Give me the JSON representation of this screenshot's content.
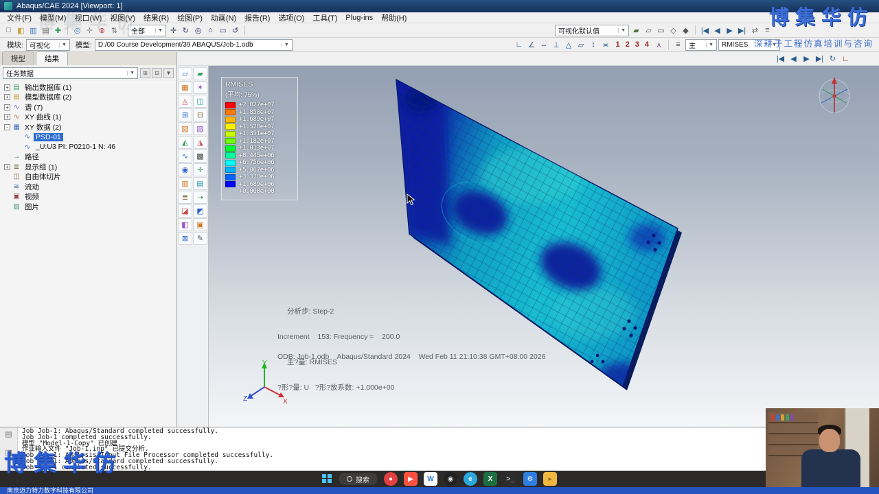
{
  "window": {
    "title": "Abaqus/CAE 2024 [Viewport: 1]"
  },
  "watermark": {
    "brand": "博集华仿",
    "tagline": "深耕于工程仿真培训与咨询"
  },
  "menu": {
    "items": [
      "文件(F)",
      "模型(M)",
      "视口(W)",
      "视图(V)",
      "结果(R)",
      "绘图(P)",
      "动画(N)",
      "报告(R)",
      "选项(O)",
      "工具(T)",
      "Plug-ins",
      "帮助(H)"
    ]
  },
  "toolbar1": {
    "file_icons": [
      {
        "name": "new-file-icon",
        "glyph": "□",
        "color": "#555"
      },
      {
        "name": "open-icon",
        "glyph": "◧",
        "color": "#c8a03a"
      },
      {
        "name": "save-icon",
        "glyph": "▥",
        "color": "#3a6fc0"
      },
      {
        "name": "print-icon",
        "glyph": "▤",
        "color": "#666"
      },
      {
        "name": "manager-icon",
        "glyph": "✚",
        "color": "#2e9e5b"
      }
    ],
    "edit_icons": [
      {
        "name": "query-icon",
        "glyph": "◎",
        "color": "#3a6fc0"
      },
      {
        "name": "tools-icon",
        "glyph": "✛",
        "color": "#888"
      },
      {
        "name": "delete-icon",
        "glyph": "⊗",
        "color": "#b04040"
      },
      {
        "name": "sort-icon",
        "glyph": "⇅",
        "color": "#666"
      }
    ],
    "display_filter": {
      "value": "全部"
    },
    "view_icons": [
      {
        "name": "pan-view-icon",
        "glyph": "✛",
        "color": "#336"
      },
      {
        "name": "rotate-view-icon",
        "glyph": "↻",
        "color": "#336"
      },
      {
        "name": "zoom-view-icon",
        "glyph": "◎",
        "color": "#336"
      },
      {
        "name": "fit-view-icon",
        "glyph": "⌂",
        "color": "#336"
      },
      {
        "name": "box-zoom-icon",
        "glyph": "▭",
        "color": "#336"
      },
      {
        "name": "cycle-views-icon",
        "glyph": "↺",
        "color": "#336"
      }
    ],
    "viz_defaults": {
      "value": "可视化默认值"
    },
    "render_icons": [
      {
        "name": "render-shaded-icon",
        "glyph": "▰",
        "color": "#4a7a3a"
      },
      {
        "name": "render-hidden-icon",
        "glyph": "▱",
        "color": "#555"
      },
      {
        "name": "render-wireframe-icon",
        "glyph": "▭",
        "color": "#555"
      },
      {
        "name": "perspective-icon",
        "glyph": "◇",
        "color": "#555"
      },
      {
        "name": "parallel-icon",
        "glyph": "◆",
        "color": "#555"
      }
    ],
    "playback_icons": [
      {
        "name": "first-frame-icon",
        "glyph": "|◀",
        "color": "#2a5a8a"
      },
      {
        "name": "previous-frame-icon",
        "glyph": "◀",
        "color": "#2a5a8a"
      },
      {
        "name": "play-animation-icon",
        "glyph": "▶",
        "color": "#2a5a8a"
      },
      {
        "name": "last-frame-icon",
        "glyph": "▶|",
        "color": "#2a5a8a"
      }
    ],
    "tail_icons": [
      {
        "name": "sync-viewports-icon",
        "glyph": "⇄",
        "color": "#666"
      },
      {
        "name": "viewport-annotations-icon",
        "glyph": "≡",
        "color": "#666"
      }
    ]
  },
  "context": {
    "module_label": "模块:",
    "module_value": "可视化",
    "model_label": "模型:",
    "model_value": "D:/00 Course Development/39 ABAQUS/Job-1.odb",
    "annotation_icons": [
      {
        "name": "measure-distance-icon",
        "glyph": "∟",
        "color": "#2a5a8a"
      },
      {
        "name": "measure-angle-icon",
        "glyph": "∠",
        "color": "#2a5a8a"
      },
      {
        "name": "annotate-arrow-icon",
        "glyph": "↔",
        "color": "#2a5a8a"
      },
      {
        "name": "annotate-text-icon",
        "glyph": "⊥",
        "color": "#2a5a8a"
      },
      {
        "name": "annotate-line-icon",
        "glyph": "△",
        "color": "#2a5a8a"
      },
      {
        "name": "annotate-box-icon",
        "glyph": "▱",
        "color": "#2a5a8a"
      },
      {
        "name": "probe-icon",
        "glyph": "↕",
        "color": "#2a5a8a"
      },
      {
        "name": "tag-icon",
        "glyph": "≍",
        "color": "#2a5a8a"
      }
    ],
    "frame_numbers": [
      "1",
      "2",
      "3",
      "4"
    ],
    "person_icon_glyph": "⋏",
    "layers_icon_glyph": "≡",
    "primary_value": "主",
    "field_value": "RMISES"
  },
  "strip_icons": [
    {
      "name": "anim-first-icon",
      "glyph": "|◀",
      "color": "#2a5a8a"
    },
    {
      "name": "anim-prev-icon",
      "glyph": "◀",
      "color": "#2a5a8a"
    },
    {
      "name": "anim-play-icon",
      "glyph": "▶",
      "color": "#2a5a8a"
    },
    {
      "name": "anim-last-icon",
      "glyph": "▶|",
      "color": "#2a5a8a"
    },
    {
      "name": "anim-loop-icon",
      "glyph": "↻",
      "color": "#2a5a8a"
    },
    {
      "name": "triad-toggle-icon",
      "glyph": "∟",
      "color": "#8a2a2a"
    }
  ],
  "tree_panel": {
    "tabs": [
      {
        "label": "模型"
      },
      {
        "label": "结果",
        "active": true
      }
    ],
    "filter_value": "任务数据",
    "filter_buttons": [
      {
        "name": "expand-all-button",
        "glyph": "⊞"
      },
      {
        "name": "collapse-all-button",
        "glyph": "⊟"
      },
      {
        "name": "tree-filter-button",
        "glyph": "▼"
      }
    ],
    "items": [
      {
        "label": "输出数据库 (1)",
        "icon": "output-database-icon",
        "glyph": "▤",
        "color": "#2e9e5b",
        "level": 0,
        "expander": "+"
      },
      {
        "label": "模型数据库 (2)",
        "icon": "model-database-icon",
        "glyph": "▤",
        "color": "#c8a03a",
        "level": 0,
        "expander": "+"
      },
      {
        "label": "谱 (7)",
        "icon": "spectrum-icon",
        "glyph": "∿",
        "color": "#7a4fc0",
        "level": 0,
        "expander": "+"
      },
      {
        "label": "XY 曲线 (1)",
        "icon": "xy-plot-icon",
        "glyph": "∿",
        "color": "#c05a2a",
        "level": 0,
        "expander": "+"
      },
      {
        "label": "XY 数据 (2)",
        "icon": "xy-data-icon",
        "glyph": "▦",
        "color": "#3a6fc0",
        "level": 0,
        "expander": "-"
      },
      {
        "label": "PSD-01",
        "icon": "xy-data-item-icon",
        "glyph": "∿",
        "color": "#3a6fc0",
        "level": 1,
        "expander": "",
        "selected": true
      },
      {
        "label": "_U:U3 PI: P0210-1 N: 46",
        "icon": "xy-data-item-icon",
        "glyph": "∿",
        "color": "#3a6fc0",
        "level": 1,
        "expander": ""
      },
      {
        "label": "路径",
        "icon": "path-icon",
        "glyph": "→",
        "color": "#3a8a4a",
        "level": 0,
        "expander": ""
      },
      {
        "label": "显示组 (1)",
        "icon": "display-group-icon",
        "glyph": "≣",
        "color": "#7a6a3a",
        "level": 0,
        "expander": "+"
      },
      {
        "label": "自由体切片",
        "icon": "free-body-cut-icon",
        "glyph": "◫",
        "color": "#8a5a3a",
        "level": 0,
        "expander": ""
      },
      {
        "label": "流动",
        "icon": "stream-icon",
        "glyph": "≋",
        "color": "#3a6a9a",
        "level": 0,
        "expander": ""
      },
      {
        "label": "视频",
        "icon": "movie-icon",
        "glyph": "▣",
        "color": "#9a4a4a",
        "level": 0,
        "expander": ""
      },
      {
        "label": "图片",
        "icon": "image-icon",
        "glyph": "▨",
        "color": "#4a9a8a",
        "level": 0,
        "expander": ""
      }
    ]
  },
  "toolbox": {
    "icons": [
      {
        "name": "plot-undeformed-icon",
        "glyph": "▱",
        "color": "#2a62c8"
      },
      {
        "name": "plot-deformed-icon",
        "glyph": "▰",
        "color": "#2e9e5b"
      },
      {
        "name": "plot-contours-icon",
        "glyph": "▦",
        "color": "#d07828"
      },
      {
        "name": "plot-symbols-icon",
        "glyph": "✶",
        "color": "#9a52c8"
      },
      {
        "name": "plot-material-orientation-icon",
        "glyph": "◬",
        "color": "#c84848"
      },
      {
        "name": "allow-multiple-plots-icon",
        "glyph": "◫",
        "color": "#2a9a9a"
      },
      {
        "name": "common-options-icon",
        "glyph": "⊞",
        "color": "#2a62c8"
      },
      {
        "name": "superimpose-options-icon",
        "glyph": "⊟",
        "color": "#7a6a3a"
      },
      {
        "name": "contour-options-icon",
        "glyph": "▧",
        "color": "#d07828"
      },
      {
        "name": "symbol-options-icon",
        "glyph": "▨",
        "color": "#9a52c8"
      },
      {
        "name": "animate-scale-factor-icon",
        "glyph": "◭",
        "color": "#2e9e5b"
      },
      {
        "name": "animate-time-history-icon",
        "glyph": "◮",
        "color": "#c84848"
      },
      {
        "name": "animate-harmonic-icon",
        "glyph": "∿",
        "color": "#2a62c8"
      },
      {
        "name": "animation-options-icon",
        "glyph": "▩",
        "color": "#4a4a4a"
      },
      {
        "name": "query-information-icon",
        "glyph": "◉",
        "color": "#2a62c8"
      },
      {
        "name": "probe-values-icon",
        "glyph": "✛",
        "color": "#2e9e5b"
      },
      {
        "name": "create-xy-data-icon",
        "glyph": "▥",
        "color": "#d07828"
      },
      {
        "name": "xy-options-icon",
        "glyph": "▤",
        "color": "#2a9a9a"
      },
      {
        "name": "operate-on-xy-icon",
        "glyph": "≣",
        "color": "#7a6a3a"
      },
      {
        "name": "path-tool-icon",
        "glyph": "➝",
        "color": "#3a8a4a"
      },
      {
        "name": "view-cut-icon",
        "glyph": "◪",
        "color": "#c84848"
      },
      {
        "name": "free-body-cut-icon",
        "glyph": "◩",
        "color": "#2a62c8"
      },
      {
        "name": "display-group-tool-icon",
        "glyph": "◧",
        "color": "#9a52c8"
      },
      {
        "name": "color-code-icon",
        "glyph": "▣",
        "color": "#d07828"
      },
      {
        "name": "field-output-icon",
        "glyph": "⊠",
        "color": "#2a62c8"
      },
      {
        "name": "result-options-icon",
        "glyph": "✎",
        "color": "#4a4a4a"
      }
    ]
  },
  "legend": {
    "title": "RMISES",
    "subtitle": "(平均: 75%)",
    "colors": [
      "#ff0000",
      "#ff7a00",
      "#ffb800",
      "#fff200",
      "#c8ff00",
      "#6eff00",
      "#00ff2e",
      "#00ff9e",
      "#00ffff",
      "#00b2ff",
      "#0064ff",
      "#0000ff"
    ],
    "values": [
      "+2.027e+07",
      "+1.858e+07",
      "+1.689e+07",
      "+1.520e+07",
      "+1.351e+07",
      "+1.182e+07",
      "+1.013e+07",
      "+8.445e+06",
      "+6.756e+06",
      "+5.067e+06",
      "+3.378e+06",
      "+1.689e+06",
      "+0.000e+00"
    ]
  },
  "viewport": {
    "odb_line": "ODB: Job-1.odb    Abaqus/Standard 2024    Wed Feb 11 21:10:38 GMT+08:00 2026",
    "step_line": "分析步: Step-2",
    "increment_line": "Increment    153: Frequency =    200.0",
    "primary_line": "主?量: RMISES",
    "deformed_line": "?形?量: U   ?形?放系数: +1.000e+00",
    "triad_x": "X",
    "triad_y": "Y",
    "triad_z": "Z"
  },
  "messages": {
    "lines": [
      "Job Job-1: Abaqus/Standard completed successfully.",
      "Job Job-1 completed successfully.",
      "模型 \"Model-1-Copy\" 已创建.",
      "作业输入文件 \"Job-1.inp\" 已提交分析.",
      "Job Job-1: Analysis Input File Processor completed successfully.",
      "Job Job-1: Abaqus/Standard completed successfully.",
      "Job Job-1 completed successfully."
    ]
  },
  "taskbar": {
    "search_label": "搜索",
    "apps": [
      {
        "name": "media-app-icon",
        "bg": "#e04040",
        "glyph": "●",
        "fg": "#ffffff",
        "circle": true
      },
      {
        "name": "capcut-app-icon",
        "bg": "#ff5040",
        "glyph": "▶",
        "fg": "#ffffff"
      },
      {
        "name": "wps-app-icon",
        "bg": "#ffffff",
        "glyph": "W",
        "fg": "#2b7cd3"
      },
      {
        "name": "record-app-icon",
        "bg": "#222222",
        "glyph": "◉",
        "fg": "#dddddd",
        "circle": true
      },
      {
        "name": "edge-browser-icon",
        "bg": "#2aa7dc",
        "glyph": "e",
        "fg": "#ffffff",
        "circle": true
      },
      {
        "name": "excel-app-icon",
        "bg": "#1d6f42",
        "glyph": "X",
        "fg": "#ffffff"
      },
      {
        "name": "terminal-app-icon",
        "bg": "#2d2d2d",
        "glyph": ">_",
        "fg": "#cccccc"
      },
      {
        "name": "settings-app-icon",
        "bg": "#2f7fe0",
        "glyph": "⚙",
        "fg": "#ffffff"
      },
      {
        "name": "file-explorer-icon",
        "bg": "#f0b840",
        "glyph": "▸",
        "fg": "#8a6a20"
      }
    ]
  },
  "statusbar": {
    "company": "南京迈力特力数字科技有限公司"
  }
}
